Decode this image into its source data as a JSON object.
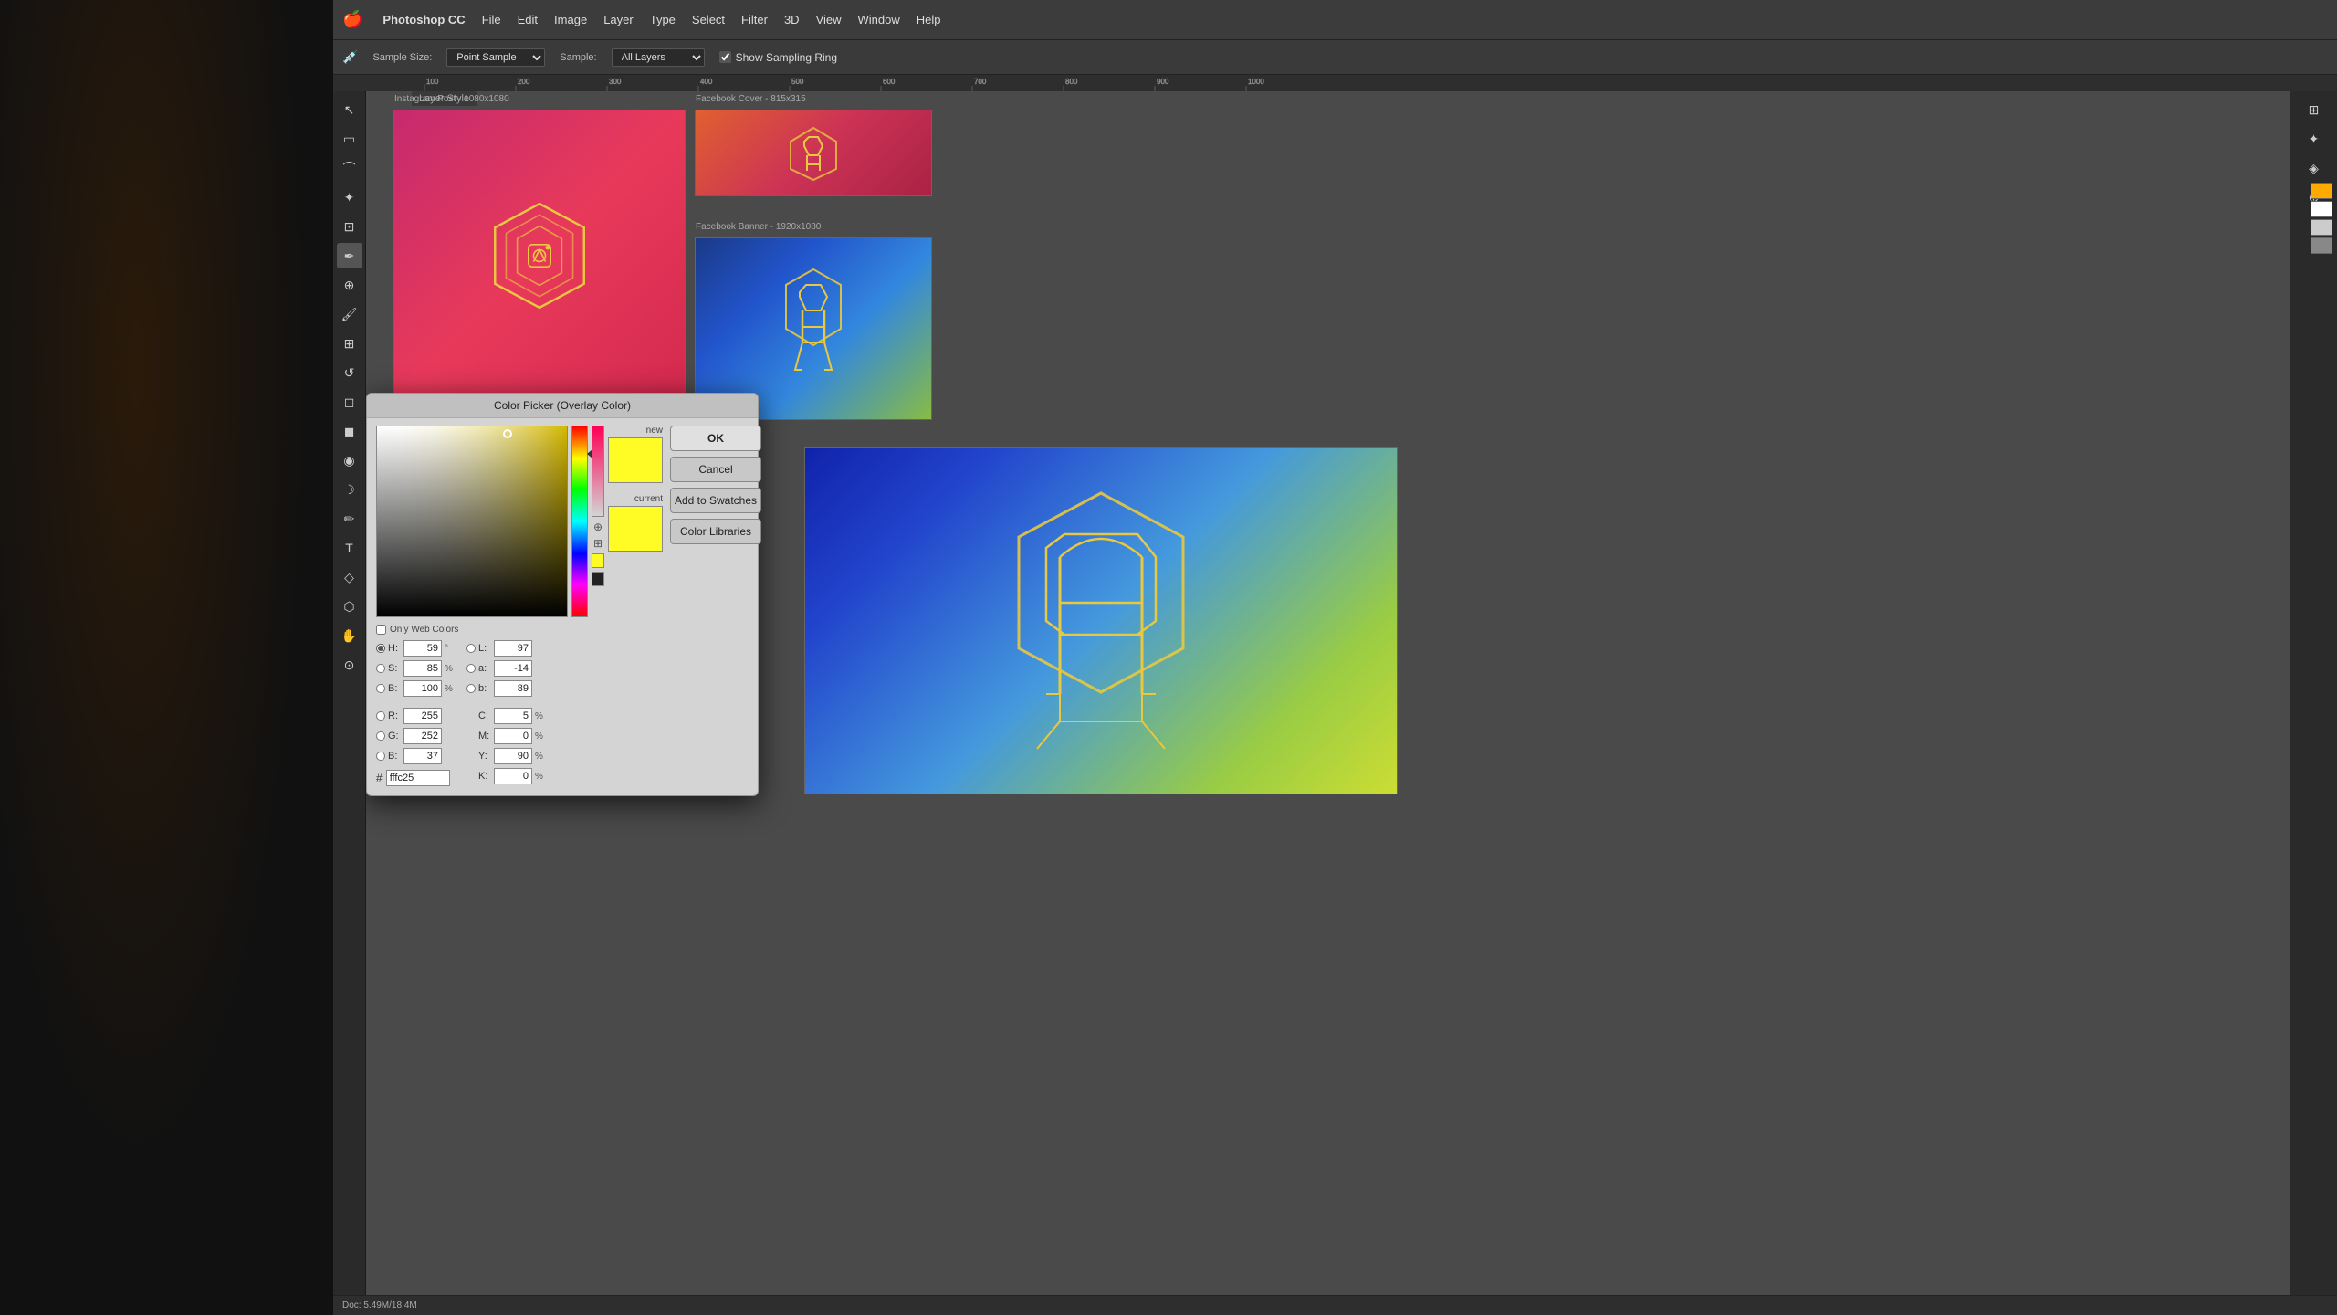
{
  "app": {
    "name": "Photoshop CC",
    "title": "Color Picker (Overlay Color)"
  },
  "menu": {
    "apple": "🍎",
    "items": [
      "Photoshop CC",
      "File",
      "Edit",
      "Image",
      "Layer",
      "Type",
      "Select",
      "Filter",
      "3D",
      "View",
      "Window",
      "Help"
    ]
  },
  "options_bar": {
    "sample_size_label": "Sample Size:",
    "sample_size_value": "Point Sample",
    "sample_label": "Sample:",
    "sample_value": "All Layers",
    "show_sampling_ring_label": "Show Sampling Ring",
    "show_sampling_ring_checked": true
  },
  "artboards": {
    "instagram": {
      "label": "Instagram Post - 1080x1080",
      "width": "1080",
      "height": "1080"
    },
    "fb_cover": {
      "label": "Facebook Cover - 815x315",
      "width": "815",
      "height": "315"
    },
    "fb_banner": {
      "label": "Facebook Banner - 1920x1080",
      "width": "1920",
      "height": "1080"
    }
  },
  "color_picker": {
    "title": "Color Picker (Overlay Color)",
    "new_label": "new",
    "current_label": "current",
    "new_color": "#fffc25",
    "current_color": "#fffc25",
    "buttons": {
      "ok": "OK",
      "cancel": "Cancel",
      "add_to_swatches": "Add to Swatches",
      "color_libraries": "Color Libraries"
    },
    "hsb": {
      "h_label": "H:",
      "h_value": "59",
      "h_unit": "",
      "s_label": "S:",
      "s_value": "85",
      "s_unit": "%",
      "b_label": "B:",
      "b_value": "100",
      "b_unit": "%"
    },
    "rgb": {
      "r_label": "R:",
      "r_value": "255",
      "g_label": "G:",
      "g_value": "252",
      "b_label": "B:",
      "b_value": "37"
    },
    "lab": {
      "l_label": "L:",
      "l_value": "97",
      "a_label": "a:",
      "a_value": "-14",
      "b_label": "b:",
      "b_value": "89"
    },
    "cmyk": {
      "c_label": "C:",
      "c_value": "5",
      "c_unit": "%",
      "m_label": "M:",
      "m_value": "0",
      "m_unit": "%",
      "y_label": "Y:",
      "y_value": "90",
      "y_unit": "%",
      "k_label": "K:",
      "k_value": "0",
      "k_unit": "%"
    },
    "hex": {
      "label": "#",
      "value": "fffc25"
    },
    "web_colors": {
      "label": "Only Web Colors",
      "checked": false
    }
  },
  "layer_style": {
    "label": "Layer Style"
  },
  "swatches": {
    "colors": [
      "#ffaa00",
      "#ff6644",
      "#ffffff",
      "#dddddd",
      "#aaaaaa"
    ]
  }
}
